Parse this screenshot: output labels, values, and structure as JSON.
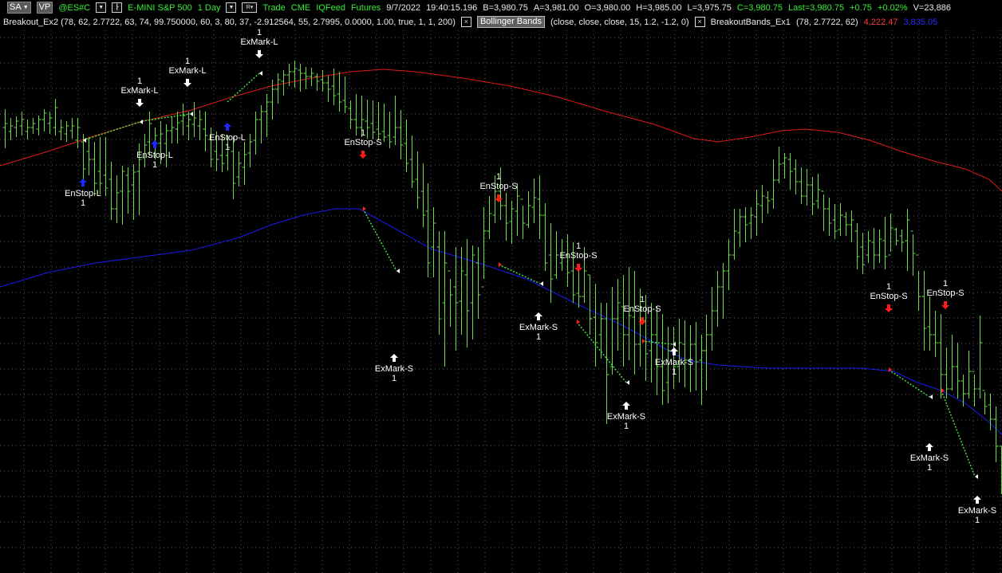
{
  "toolbar": {
    "sa_label": "SA",
    "vp_label": "VP",
    "symbol": "@ES#C",
    "description": "E-MINI S&P 500",
    "interval": "1 Day",
    "r_label": "R",
    "trade_label": "Trade",
    "exchange": "CME",
    "feed": "IQFeed",
    "category": "Futures",
    "date": "9/7/2022",
    "time": "19:40:15.196",
    "bid": "B=3,980.75",
    "ask": "A=3,981.00",
    "open": "O=3,980.00",
    "high": "H=3,985.00",
    "low": "L=3,975.75",
    "close": "C=3,980.75",
    "last": "Last=3,980.75",
    "change": "+0.75",
    "change_pct": "+0.02%",
    "volume": "V=23,886"
  },
  "indicator_bar": {
    "strategy": "Breakout_Ex2 (78, 62, 2.7722, 63, 74, 99.750000, 60, 3, 80, 37, -2.912564, 55, 2.7995, 0.0000, 1.00, true, 1, 1, 200)",
    "close_x": "×",
    "bollinger_label": "Bollinger Bands",
    "bollinger_params": "(close, close, close, 15, 1.2, -1.2, 0)",
    "bands_name": "BreakoutBands_Ex1",
    "bands_params": "(78, 2.7722, 62)",
    "upper_value": "4,222.47",
    "lower_value": "3,835.05"
  },
  "colors": {
    "background": "#000000",
    "bar": "#66dd44",
    "upper_band": "#e01818",
    "lower_band": "#1a1aee",
    "entry_long_arrow": "#1a2aff",
    "entry_short_arrow": "#ff1a1a",
    "exit_arrow": "#ffffff",
    "trade_line": "#44ee44"
  },
  "chart_data": {
    "type": "ohlc",
    "bars": [
      {
        "h": 137,
        "l": 186,
        "o": 160,
        "c": 155
      },
      {
        "h": 148,
        "l": 176,
        "o": 165,
        "c": 158
      },
      {
        "h": 146,
        "l": 172,
        "o": 160,
        "c": 152
      },
      {
        "h": 140,
        "l": 170,
        "o": 158,
        "c": 150
      },
      {
        "h": 150,
        "l": 175,
        "o": 165,
        "c": 160
      },
      {
        "h": 148,
        "l": 168,
        "o": 160,
        "c": 155
      },
      {
        "h": 145,
        "l": 170,
        "o": 162,
        "c": 150
      },
      {
        "h": 137,
        "l": 165,
        "o": 150,
        "c": 142
      },
      {
        "h": 140,
        "l": 168,
        "o": 155,
        "c": 148
      },
      {
        "h": 124,
        "l": 170,
        "o": 160,
        "c": 135
      },
      {
        "h": 150,
        "l": 176,
        "o": 165,
        "c": 160
      },
      {
        "h": 152,
        "l": 178,
        "o": 168,
        "c": 158
      },
      {
        "h": 148,
        "l": 174,
        "o": 164,
        "c": 158
      },
      {
        "h": 148,
        "l": 186,
        "o": 176,
        "c": 160
      },
      {
        "h": 168,
        "l": 232,
        "o": 178,
        "c": 212
      },
      {
        "h": 172,
        "l": 220,
        "o": 190,
        "c": 200
      },
      {
        "h": 178,
        "l": 246,
        "o": 200,
        "c": 230
      },
      {
        "h": 172,
        "l": 244,
        "o": 215,
        "c": 230
      },
      {
        "h": 172,
        "l": 246,
        "o": 220,
        "c": 236
      },
      {
        "h": 203,
        "l": 276,
        "o": 225,
        "c": 262
      },
      {
        "h": 220,
        "l": 280,
        "o": 262,
        "c": 242
      },
      {
        "h": 208,
        "l": 282,
        "o": 240,
        "c": 215
      },
      {
        "h": 210,
        "l": 268,
        "o": 220,
        "c": 240
      },
      {
        "h": 206,
        "l": 276,
        "o": 232,
        "c": 216
      },
      {
        "h": 180,
        "l": 270,
        "o": 215,
        "c": 200
      },
      {
        "h": 168,
        "l": 210,
        "o": 198,
        "c": 182
      },
      {
        "h": 140,
        "l": 196,
        "o": 178,
        "c": 155
      },
      {
        "h": 160,
        "l": 200,
        "o": 180,
        "c": 170
      },
      {
        "h": 152,
        "l": 206,
        "o": 180,
        "c": 168
      },
      {
        "h": 156,
        "l": 210,
        "o": 180,
        "c": 164
      },
      {
        "h": 146,
        "l": 180,
        "o": 164,
        "c": 160
      },
      {
        "h": 140,
        "l": 180,
        "o": 162,
        "c": 154
      },
      {
        "h": 130,
        "l": 170,
        "o": 152,
        "c": 145
      },
      {
        "h": 140,
        "l": 176,
        "o": 158,
        "c": 150
      },
      {
        "h": 128,
        "l": 172,
        "o": 156,
        "c": 148
      },
      {
        "h": 138,
        "l": 176,
        "o": 158,
        "c": 150
      },
      {
        "h": 140,
        "l": 190,
        "o": 162,
        "c": 170
      },
      {
        "h": 160,
        "l": 210,
        "o": 175,
        "c": 200
      },
      {
        "h": 165,
        "l": 215,
        "o": 190,
        "c": 200
      },
      {
        "h": 168,
        "l": 216,
        "o": 195,
        "c": 205
      },
      {
        "h": 170,
        "l": 214,
        "o": 195,
        "c": 185
      },
      {
        "h": 172,
        "l": 250,
        "o": 190,
        "c": 230
      },
      {
        "h": 190,
        "l": 234,
        "o": 222,
        "c": 205
      },
      {
        "h": 178,
        "l": 232,
        "o": 210,
        "c": 194
      },
      {
        "h": 168,
        "l": 210,
        "o": 192,
        "c": 178
      },
      {
        "h": 140,
        "l": 194,
        "o": 176,
        "c": 150
      },
      {
        "h": 132,
        "l": 180,
        "o": 150,
        "c": 140
      },
      {
        "h": 118,
        "l": 172,
        "o": 140,
        "c": 128
      },
      {
        "h": 100,
        "l": 150,
        "o": 128,
        "c": 112
      },
      {
        "h": 92,
        "l": 130,
        "o": 112,
        "c": 100
      },
      {
        "h": 88,
        "l": 120,
        "o": 102,
        "c": 94
      },
      {
        "h": 80,
        "l": 108,
        "o": 94,
        "c": 90
      },
      {
        "h": 76,
        "l": 110,
        "o": 90,
        "c": 86
      },
      {
        "h": 80,
        "l": 115,
        "o": 88,
        "c": 92
      },
      {
        "h": 84,
        "l": 112,
        "o": 92,
        "c": 96
      },
      {
        "h": 85,
        "l": 108,
        "o": 96,
        "c": 92
      },
      {
        "h": 92,
        "l": 114,
        "o": 96,
        "c": 102
      },
      {
        "h": 88,
        "l": 115,
        "o": 100,
        "c": 104
      },
      {
        "h": 95,
        "l": 128,
        "o": 104,
        "c": 112
      },
      {
        "h": 86,
        "l": 132,
        "o": 108,
        "c": 120
      },
      {
        "h": 90,
        "l": 140,
        "o": 118,
        "c": 128
      },
      {
        "h": 96,
        "l": 142,
        "o": 126,
        "c": 134
      },
      {
        "h": 126,
        "l": 162,
        "o": 136,
        "c": 150
      },
      {
        "h": 118,
        "l": 170,
        "o": 150,
        "c": 160
      },
      {
        "h": 120,
        "l": 172,
        "o": 160,
        "c": 150
      },
      {
        "h": 125,
        "l": 174,
        "o": 152,
        "c": 160
      },
      {
        "h": 126,
        "l": 175,
        "o": 155,
        "c": 166
      },
      {
        "h": 128,
        "l": 176,
        "o": 162,
        "c": 168
      },
      {
        "h": 130,
        "l": 178,
        "o": 165,
        "c": 172
      },
      {
        "h": 140,
        "l": 186,
        "o": 170,
        "c": 178
      },
      {
        "h": 120,
        "l": 182,
        "o": 172,
        "c": 160
      },
      {
        "h": 138,
        "l": 200,
        "o": 160,
        "c": 182
      },
      {
        "h": 150,
        "l": 216,
        "o": 180,
        "c": 205
      },
      {
        "h": 170,
        "l": 236,
        "o": 200,
        "c": 228
      },
      {
        "h": 190,
        "l": 262,
        "o": 225,
        "c": 248
      },
      {
        "h": 205,
        "l": 285,
        "o": 240,
        "c": 270
      },
      {
        "h": 230,
        "l": 348,
        "o": 265,
        "c": 330
      },
      {
        "h": 260,
        "l": 348,
        "o": 310,
        "c": 280
      },
      {
        "h": 290,
        "l": 420,
        "o": 310,
        "c": 400
      },
      {
        "h": 290,
        "l": 460,
        "o": 380,
        "c": 330
      },
      {
        "h": 350,
        "l": 410,
        "o": 340,
        "c": 370
      },
      {
        "h": 310,
        "l": 440,
        "o": 360,
        "c": 380
      },
      {
        "h": 310,
        "l": 420,
        "o": 378,
        "c": 340
      },
      {
        "h": 300,
        "l": 436,
        "o": 345,
        "c": 390
      },
      {
        "h": 308,
        "l": 426,
        "o": 380,
        "c": 320
      },
      {
        "h": 310,
        "l": 400,
        "o": 330,
        "c": 370
      },
      {
        "h": 260,
        "l": 350,
        "o": 360,
        "c": 290
      },
      {
        "h": 246,
        "l": 300,
        "o": 290,
        "c": 268
      },
      {
        "h": 220,
        "l": 280,
        "o": 270,
        "c": 240
      },
      {
        "h": 210,
        "l": 276,
        "o": 240,
        "c": 258
      },
      {
        "h": 242,
        "l": 302,
        "o": 258,
        "c": 280
      },
      {
        "h": 252,
        "l": 306,
        "o": 278,
        "c": 262
      },
      {
        "h": 230,
        "l": 296,
        "o": 265,
        "c": 246
      },
      {
        "h": 258,
        "l": 300,
        "o": 250,
        "c": 280
      },
      {
        "h": 240,
        "l": 286,
        "o": 282,
        "c": 258
      },
      {
        "h": 224,
        "l": 280,
        "o": 260,
        "c": 248
      },
      {
        "h": 220,
        "l": 300,
        "o": 250,
        "c": 270
      },
      {
        "h": 255,
        "l": 340,
        "o": 270,
        "c": 330
      },
      {
        "h": 280,
        "l": 380,
        "o": 320,
        "c": 350
      },
      {
        "h": 290,
        "l": 350,
        "o": 345,
        "c": 320
      },
      {
        "h": 300,
        "l": 340,
        "o": 330,
        "c": 320
      },
      {
        "h": 294,
        "l": 360,
        "o": 320,
        "c": 342
      },
      {
        "h": 304,
        "l": 380,
        "o": 340,
        "c": 370
      },
      {
        "h": 340,
        "l": 386,
        "o": 368,
        "c": 372
      },
      {
        "h": 310,
        "l": 380,
        "o": 372,
        "c": 340
      },
      {
        "h": 345,
        "l": 420,
        "o": 345,
        "c": 400
      },
      {
        "h": 356,
        "l": 460,
        "o": 398,
        "c": 430
      },
      {
        "h": 380,
        "l": 450,
        "o": 420,
        "c": 400
      },
      {
        "h": 380,
        "l": 532,
        "o": 400,
        "c": 470
      },
      {
        "h": 360,
        "l": 470,
        "o": 460,
        "c": 400
      },
      {
        "h": 350,
        "l": 440,
        "o": 400,
        "c": 380
      },
      {
        "h": 345,
        "l": 460,
        "o": 385,
        "c": 420
      },
      {
        "h": 335,
        "l": 452,
        "o": 420,
        "c": 396
      },
      {
        "h": 340,
        "l": 470,
        "o": 398,
        "c": 432
      },
      {
        "h": 362,
        "l": 460,
        "o": 432,
        "c": 402
      },
      {
        "h": 370,
        "l": 478,
        "o": 402,
        "c": 444
      },
      {
        "h": 380,
        "l": 480,
        "o": 440,
        "c": 420
      },
      {
        "h": 384,
        "l": 496,
        "o": 420,
        "c": 460
      },
      {
        "h": 394,
        "l": 508,
        "o": 460,
        "c": 490
      },
      {
        "h": 410,
        "l": 506,
        "o": 480,
        "c": 440
      },
      {
        "h": 410,
        "l": 488,
        "o": 440,
        "c": 460
      },
      {
        "h": 400,
        "l": 480,
        "o": 460,
        "c": 430
      },
      {
        "h": 402,
        "l": 486,
        "o": 432,
        "c": 452
      },
      {
        "h": 408,
        "l": 492,
        "o": 452,
        "c": 432
      },
      {
        "h": 404,
        "l": 490,
        "o": 432,
        "c": 454
      },
      {
        "h": 420,
        "l": 508,
        "o": 452,
        "c": 440
      },
      {
        "h": 395,
        "l": 490,
        "o": 440,
        "c": 420
      },
      {
        "h": 360,
        "l": 440,
        "o": 420,
        "c": 390
      },
      {
        "h": 340,
        "l": 410,
        "o": 390,
        "c": 360
      },
      {
        "h": 330,
        "l": 400,
        "o": 360,
        "c": 340
      },
      {
        "h": 300,
        "l": 364,
        "o": 340,
        "c": 320
      },
      {
        "h": 262,
        "l": 326,
        "o": 320,
        "c": 290
      },
      {
        "h": 262,
        "l": 310,
        "o": 292,
        "c": 272
      },
      {
        "h": 260,
        "l": 304,
        "o": 272,
        "c": 282
      },
      {
        "h": 260,
        "l": 300,
        "o": 280,
        "c": 270
      },
      {
        "h": 238,
        "l": 296,
        "o": 272,
        "c": 256
      },
      {
        "h": 232,
        "l": 280,
        "o": 258,
        "c": 246
      },
      {
        "h": 240,
        "l": 268,
        "o": 248,
        "c": 252
      },
      {
        "h": 200,
        "l": 262,
        "o": 250,
        "c": 226
      },
      {
        "h": 184,
        "l": 230,
        "o": 226,
        "c": 206
      },
      {
        "h": 192,
        "l": 224,
        "o": 205,
        "c": 198
      },
      {
        "h": 192,
        "l": 238,
        "o": 200,
        "c": 215
      },
      {
        "h": 200,
        "l": 244,
        "o": 212,
        "c": 228
      },
      {
        "h": 210,
        "l": 256,
        "o": 228,
        "c": 246
      },
      {
        "h": 212,
        "l": 258,
        "o": 246,
        "c": 232
      },
      {
        "h": 222,
        "l": 270,
        "o": 232,
        "c": 256
      },
      {
        "h": 218,
        "l": 262,
        "o": 252,
        "c": 238
      },
      {
        "h": 244,
        "l": 290,
        "o": 240,
        "c": 262
      },
      {
        "h": 248,
        "l": 296,
        "o": 262,
        "c": 280
      },
      {
        "h": 256,
        "l": 300,
        "o": 276,
        "c": 290
      },
      {
        "h": 255,
        "l": 296,
        "o": 288,
        "c": 270
      },
      {
        "h": 266,
        "l": 296,
        "o": 272,
        "c": 282
      },
      {
        "h": 264,
        "l": 304,
        "o": 282,
        "c": 276
      },
      {
        "h": 280,
        "l": 338,
        "o": 290,
        "c": 322
      },
      {
        "h": 292,
        "l": 344,
        "o": 310,
        "c": 332
      },
      {
        "h": 290,
        "l": 330,
        "o": 320,
        "c": 302
      },
      {
        "h": 286,
        "l": 338,
        "o": 304,
        "c": 320
      },
      {
        "h": 288,
        "l": 330,
        "o": 320,
        "c": 300
      },
      {
        "h": 272,
        "l": 338,
        "o": 302,
        "c": 322
      },
      {
        "h": 268,
        "l": 316,
        "o": 320,
        "c": 286
      },
      {
        "h": 286,
        "l": 308,
        "o": 288,
        "c": 302
      },
      {
        "h": 288,
        "l": 316,
        "o": 296,
        "c": 304
      },
      {
        "h": 262,
        "l": 340,
        "o": 302,
        "c": 276
      },
      {
        "h": 294,
        "l": 346,
        "o": 290,
        "c": 318
      },
      {
        "h": 340,
        "l": 390,
        "o": 320,
        "c": 372
      },
      {
        "h": 340,
        "l": 440,
        "o": 372,
        "c": 412
      },
      {
        "h": 372,
        "l": 440,
        "o": 410,
        "c": 420
      },
      {
        "h": 390,
        "l": 448,
        "o": 420,
        "c": 430
      },
      {
        "h": 394,
        "l": 500,
        "o": 430,
        "c": 470
      },
      {
        "h": 436,
        "l": 500,
        "o": 470,
        "c": 488
      },
      {
        "h": 420,
        "l": 490,
        "o": 488,
        "c": 460
      },
      {
        "h": 430,
        "l": 500,
        "o": 460,
        "c": 478
      },
      {
        "h": 470,
        "l": 510,
        "o": 478,
        "c": 494
      },
      {
        "h": 440,
        "l": 500,
        "o": 494,
        "c": 466
      },
      {
        "h": 470,
        "l": 510,
        "o": 466,
        "c": 488
      },
      {
        "h": 396,
        "l": 500,
        "o": 488,
        "c": 430
      },
      {
        "h": 492,
        "l": 520,
        "o": 490,
        "c": 510
      },
      {
        "h": 494,
        "l": 540,
        "o": 508,
        "c": 526
      },
      {
        "h": 510,
        "l": 580,
        "o": 526,
        "c": 560
      },
      {
        "h": 560,
        "l": 620,
        "o": 560,
        "c": 600
      },
      {
        "h": 566,
        "l": 600,
        "o": 600,
        "c": 580
      },
      {
        "h": 580,
        "l": 640,
        "o": 580,
        "c": 610
      },
      {
        "h": 590,
        "l": 685,
        "o": 610,
        "c": 650
      }
    ]
  },
  "signals": [
    {
      "label": "EnStop-L",
      "qty": "1",
      "dir": "long"
    },
    {
      "label": "EnStop-L",
      "qty": "1",
      "dir": "long"
    },
    {
      "label": "ExMark-L",
      "qty": "1",
      "dir": "exit-long"
    },
    {
      "label": "ExMark-L",
      "qty": "1",
      "dir": "exit-long"
    },
    {
      "label": "EnStop-L",
      "qty": "1",
      "dir": "long"
    },
    {
      "label": "ExMark-L",
      "qty": "1",
      "dir": "exit-long"
    },
    {
      "label": "EnStop-S",
      "qty": "1",
      "dir": "short"
    },
    {
      "label": "ExMark-S",
      "qty": "1",
      "dir": "exit-short"
    },
    {
      "label": "EnStop-S",
      "qty": "1",
      "dir": "short"
    },
    {
      "label": "ExMark-S",
      "qty": "1",
      "dir": "exit-short"
    },
    {
      "label": "EnStop-S",
      "qty": "1",
      "dir": "short"
    },
    {
      "label": "ExMark-S",
      "qty": "1",
      "dir": "exit-short"
    },
    {
      "label": "EnStop-S",
      "qty": "1",
      "dir": "short"
    },
    {
      "label": "ExMark-S",
      "qty": "1",
      "dir": "exit-short"
    },
    {
      "label": "EnStop-S",
      "qty": "1",
      "dir": "short"
    },
    {
      "label": "ExMark-S",
      "qty": "1",
      "dir": "exit-short"
    },
    {
      "label": "EnStop-S",
      "qty": "1",
      "dir": "short"
    },
    {
      "label": "ExMark-S",
      "qty": "1",
      "dir": "exit-short"
    }
  ]
}
